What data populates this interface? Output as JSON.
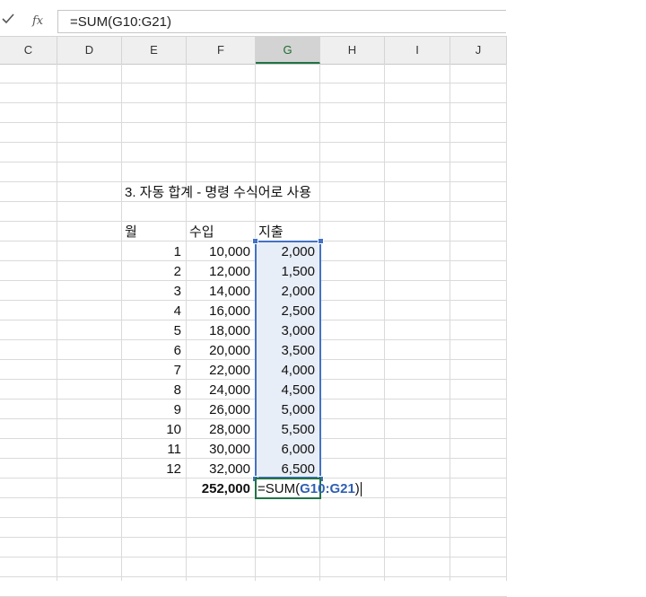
{
  "formula_bar": {
    "fx_label": "fx",
    "formula": "=SUM(G10:G21)"
  },
  "columns": [
    "C",
    "D",
    "E",
    "F",
    "G",
    "H",
    "I",
    "J"
  ],
  "active_column": "G",
  "sheet": {
    "title": "3. 자동 합계 - 명령 수식어로 사용",
    "headers": {
      "month": "월",
      "income": "수입",
      "expense": "지출"
    },
    "rows": [
      {
        "month": "1",
        "income": "10,000",
        "expense": "2,000"
      },
      {
        "month": "2",
        "income": "12,000",
        "expense": "1,500"
      },
      {
        "month": "3",
        "income": "14,000",
        "expense": "2,000"
      },
      {
        "month": "4",
        "income": "16,000",
        "expense": "2,500"
      },
      {
        "month": "5",
        "income": "18,000",
        "expense": "3,000"
      },
      {
        "month": "6",
        "income": "20,000",
        "expense": "3,500"
      },
      {
        "month": "7",
        "income": "22,000",
        "expense": "4,000"
      },
      {
        "month": "8",
        "income": "24,000",
        "expense": "4,500"
      },
      {
        "month": "9",
        "income": "26,000",
        "expense": "5,000"
      },
      {
        "month": "10",
        "income": "28,000",
        "expense": "5,500"
      },
      {
        "month": "11",
        "income": "30,000",
        "expense": "6,000"
      },
      {
        "month": "12",
        "income": "32,000",
        "expense": "6,500"
      }
    ],
    "income_total": "252,000",
    "editing_cell": {
      "prefix": "=SUM(",
      "ref": "G10:G21",
      "suffix": ")"
    }
  },
  "colors": {
    "selection": "#4472c4",
    "active": "#217346",
    "reference_text": "#2f5fb3"
  }
}
